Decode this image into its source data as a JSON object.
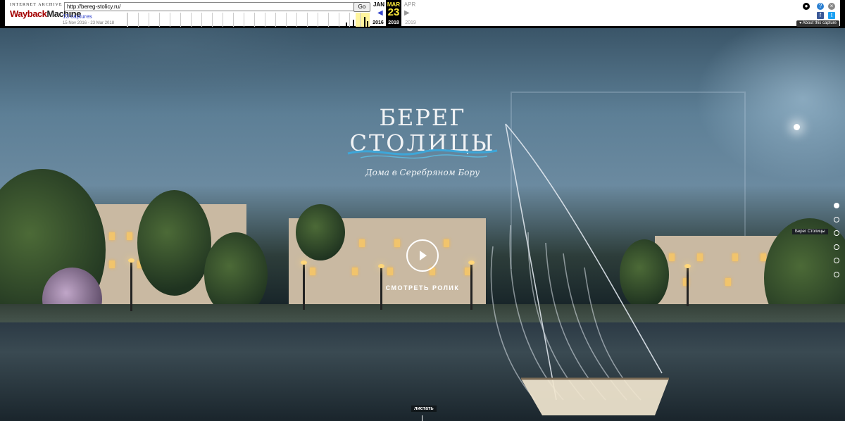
{
  "wayback": {
    "logo_top": "INTERNET ARCHIVE",
    "logo_word1": "Wayback",
    "logo_word2": "Machine",
    "url": "http://bereg-stolicy.ru/",
    "go_label": "Go",
    "captures": "13 captures",
    "range": "15 Nov 2016 - 23 Mar 2018",
    "prev_month": "JAN",
    "cur_month": "MAR",
    "next_month": "APR",
    "day": "23",
    "prev_year": "2016",
    "cur_year": "2018",
    "next_year": "2019",
    "about": "About this capture",
    "colors": {
      "highlight": "#fff59d",
      "day": "#ffeb3b",
      "link": "#3344cc"
    }
  },
  "hero": {
    "brand_line1": "БЕРЕГ",
    "brand_line2": "СТОЛИЦЫ",
    "subtitle": "Дома в Серебряном Бору",
    "watch_label": "СМОТРЕТЬ РОЛИК",
    "scroll_label": "листать"
  },
  "side_nav": {
    "tooltip": "Берег Столицы",
    "dot_count": 6,
    "active_index": 0
  },
  "icons": [
    "user-icon",
    "help-icon",
    "close-icon",
    "facebook-icon",
    "twitter-icon",
    "play-icon"
  ]
}
